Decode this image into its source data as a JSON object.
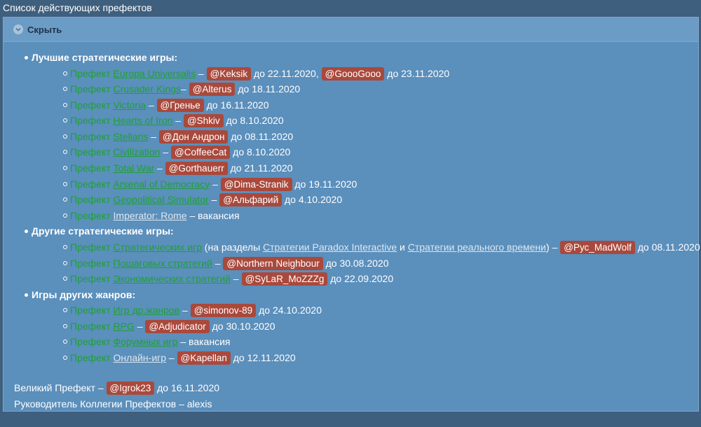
{
  "page": {
    "title": "Список действующих префектов"
  },
  "spoiler": {
    "toggle_label": "Скрыть"
  },
  "categories": [
    {
      "title": "Лучшие стратегические игры:",
      "items": [
        {
          "prefix": "Префект ",
          "game": "Europa Universalis",
          "sep": " – ",
          "users": [
            {
              "name": "@Keksik",
              "until": " до 22.11.2020, "
            },
            {
              "name": "@GoooGooo",
              "until": " до 23.11.2020"
            }
          ]
        },
        {
          "prefix": "Префект ",
          "game": "Crusader Kings",
          "sep": "– ",
          "users": [
            {
              "name": "@Alterus",
              "until": " до 18.11.2020"
            }
          ]
        },
        {
          "prefix": "Префект ",
          "game": "Victoria",
          "sep": " – ",
          "users": [
            {
              "name": "@Гренье",
              "until": " до 16.11.2020"
            }
          ]
        },
        {
          "prefix": "Префект ",
          "game": "Hearts of Iron",
          "sep": " – ",
          "users": [
            {
              "name": "@Shkiv",
              "until": " до 8.10.2020"
            }
          ]
        },
        {
          "prefix": "Префект ",
          "game": "Stellaris",
          "sep": " – ",
          "users": [
            {
              "name": "@Дон Андрон",
              "until": " до 08.11.2020"
            }
          ]
        },
        {
          "prefix": "Префект ",
          "game": "Civilization",
          "sep": " – ",
          "users": [
            {
              "name": "@CoffeeCat",
              "until": " до 8.10.2020"
            }
          ]
        },
        {
          "prefix": "Префект ",
          "game": "Total War",
          "sep": " – ",
          "users": [
            {
              "name": "@Gorthauerr",
              "until": " до 21.11.2020"
            }
          ]
        },
        {
          "prefix": "Префект ",
          "game": "Arsenal of Democracy",
          "sep": " – ",
          "users": [
            {
              "name": "@Dima-Stranik",
              "until": " до 19.11.2020"
            }
          ]
        },
        {
          "prefix": "Префект ",
          "game": "Geopolitical Simulator",
          "sep": " – ",
          "users": [
            {
              "name": "@Альфарий",
              "until": " до 4.10.2020"
            }
          ]
        },
        {
          "prefix": "Префект ",
          "game": "Imperator: Rome",
          "game_white": true,
          "sep": " – ",
          "vacancy": "вакансия"
        }
      ]
    },
    {
      "title": "Другие стратегические игры:",
      "items": [
        {
          "prefix": "Префект ",
          "game": "Стратегических игр",
          "extra": {
            "open": " (на разделы ",
            "link1": "Стратегии Paradox Interactive",
            "and": " и ",
            "link2": "Стратегии реального времени",
            "close": ")"
          },
          "sep": " – ",
          "users": [
            {
              "name": "@Рус_MadWolf",
              "until": " до 08.11.2020"
            }
          ]
        },
        {
          "prefix": "Префект ",
          "game": "Пошаговых стратегий",
          "sep": " – ",
          "users": [
            {
              "name": "@Northern Neighbour",
              "until": " до 30.08.2020"
            }
          ]
        },
        {
          "prefix": "Префект ",
          "game": "Экономических стратегий",
          "sep": " – ",
          "users": [
            {
              "name": "@SyLaR_MoZZZg",
              "until": " до 22.09.2020"
            }
          ]
        }
      ]
    },
    {
      "title": "Игры других жанров:",
      "items": [
        {
          "prefix": "Префект ",
          "game": "Игр др.жанров",
          "sep": " – ",
          "users": [
            {
              "name": "@simonov-89",
              "until": " до 24.10.2020"
            }
          ]
        },
        {
          "prefix": "Префект ",
          "game": "RPG",
          "sep": " – ",
          "users": [
            {
              "name": "@Adjudicator",
              "until": " до 30.10.2020"
            }
          ]
        },
        {
          "prefix": "Префект ",
          "game": "Форумных игр",
          "sep": " – ",
          "vacancy": "вакансия"
        },
        {
          "prefix": "Префект ",
          "game": "Онлайн-игр",
          "game_white": true,
          "sep": "  – ",
          "users": [
            {
              "name": "@Kapellan",
              "until": " до 12.11.2020"
            }
          ]
        }
      ]
    }
  ],
  "footer": {
    "great_prefect": {
      "label": "Великий Префект – ",
      "name": "@Igrok23",
      "until": " до 16.11.2020"
    },
    "head": {
      "text": "Руководитель Коллегии Префектов – alexis"
    }
  },
  "colors": {
    "background": "#3f5f7e",
    "panel": "#5b8fbc",
    "green_link": "#1fa037",
    "mention_tag": "#a9493c"
  },
  "icons": {
    "toggle": "chevron-down-icon"
  }
}
